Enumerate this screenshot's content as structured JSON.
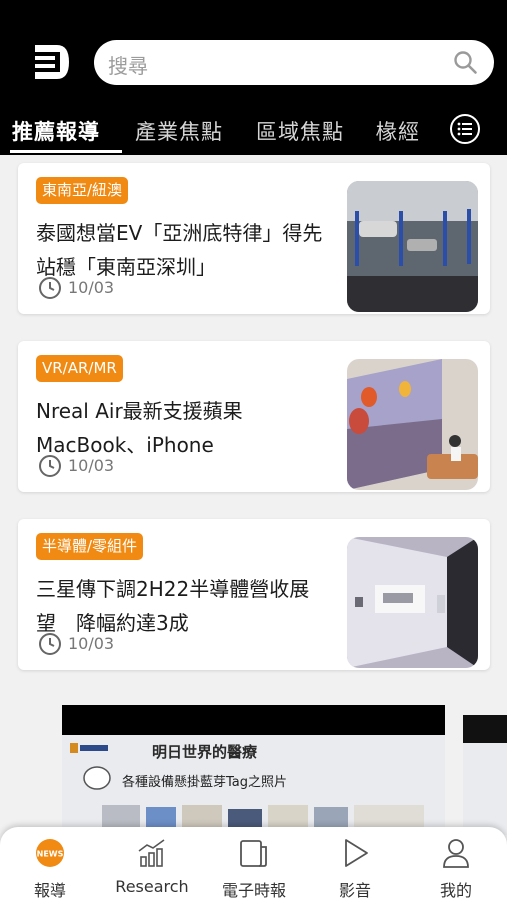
{
  "header": {
    "search_placeholder": "搜尋",
    "tabs": [
      "推薦報導",
      "產業焦點",
      "區域焦點",
      "椽經"
    ]
  },
  "articles": [
    {
      "tag": "東南亞/紐澳",
      "title": "泰國想當EV「亞洲底特律」得先站穩「東南亞深圳」",
      "date": "10/03"
    },
    {
      "tag": "VR/AR/MR",
      "title": "Nreal Air最新支援蘋果MacBook、iPhone",
      "date": "10/03"
    },
    {
      "tag": "半導體/零組件",
      "title": "三星傳下調2H22半導體營收展望　降幅約達3成",
      "date": "10/03"
    }
  ],
  "banner": {
    "title": "明日世界的醫療",
    "subtitle": "各種設備懸掛藍芽Tag之照片"
  },
  "bottom_nav": {
    "items": [
      "報導",
      "Research",
      "電子時報",
      "影音",
      "我的"
    ],
    "news_badge": "NEWS"
  },
  "colors": {
    "accent": "#f08a12",
    "header_bg": "#000000"
  }
}
